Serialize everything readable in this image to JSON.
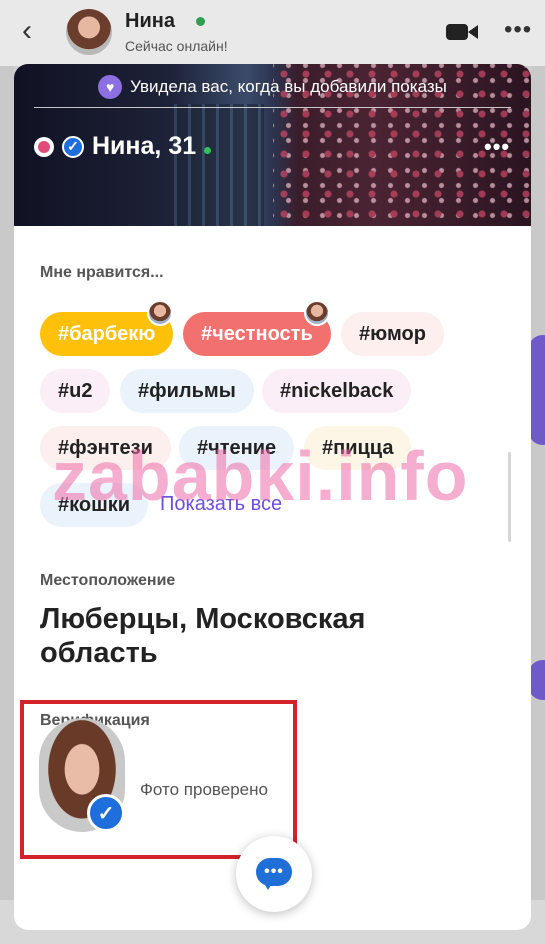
{
  "background": {
    "chat_header": {
      "back_icon": "chevron-left-icon",
      "contact_name": "Нина",
      "status": "Сейчас онлайн!",
      "video_icon": "video-camera-icon",
      "more_icon": "more-horizontal-icon"
    }
  },
  "profile": {
    "banner_text": "Увидела вас, когда вы добавили показы",
    "banner_icon": "heart-shield-icon",
    "name_age": "Нина, 31",
    "more_icon": "more-horizontal-icon",
    "likes": {
      "title": "Мне нравится...",
      "tags": [
        {
          "label": "#барбекю",
          "bg": "#ffc00a",
          "active": true,
          "shared": true
        },
        {
          "label": "#честность",
          "bg": "#f2716e",
          "active": true,
          "shared": true
        },
        {
          "label": "#юмор",
          "bg": "#fcefee"
        },
        {
          "label": "#u2",
          "bg": "#fbeef6"
        },
        {
          "label": "#фильмы",
          "bg": "#eaf3fb"
        },
        {
          "label": "#nickelback",
          "bg": "#fbeef6"
        },
        {
          "label": "#фэнтези",
          "bg": "#fcefee"
        },
        {
          "label": "#чтение",
          "bg": "#eaf3fb"
        },
        {
          "label": "#пицца",
          "bg": "#fdf6e6"
        },
        {
          "label": "#кошки",
          "bg": "#eaf3fb"
        }
      ],
      "show_all": "Показать все"
    },
    "location": {
      "title": "Местоположение",
      "value": "Люберцы, Московская область"
    },
    "verification": {
      "title": "Верификация",
      "status": "Фото проверено"
    },
    "chat_button_icon": "chat-bubble-icon"
  },
  "watermark": "zababki.info",
  "colors": {
    "accent": "#6b4ee0",
    "verified": "#1e6fdc",
    "highlight_box": "#d4222a"
  }
}
